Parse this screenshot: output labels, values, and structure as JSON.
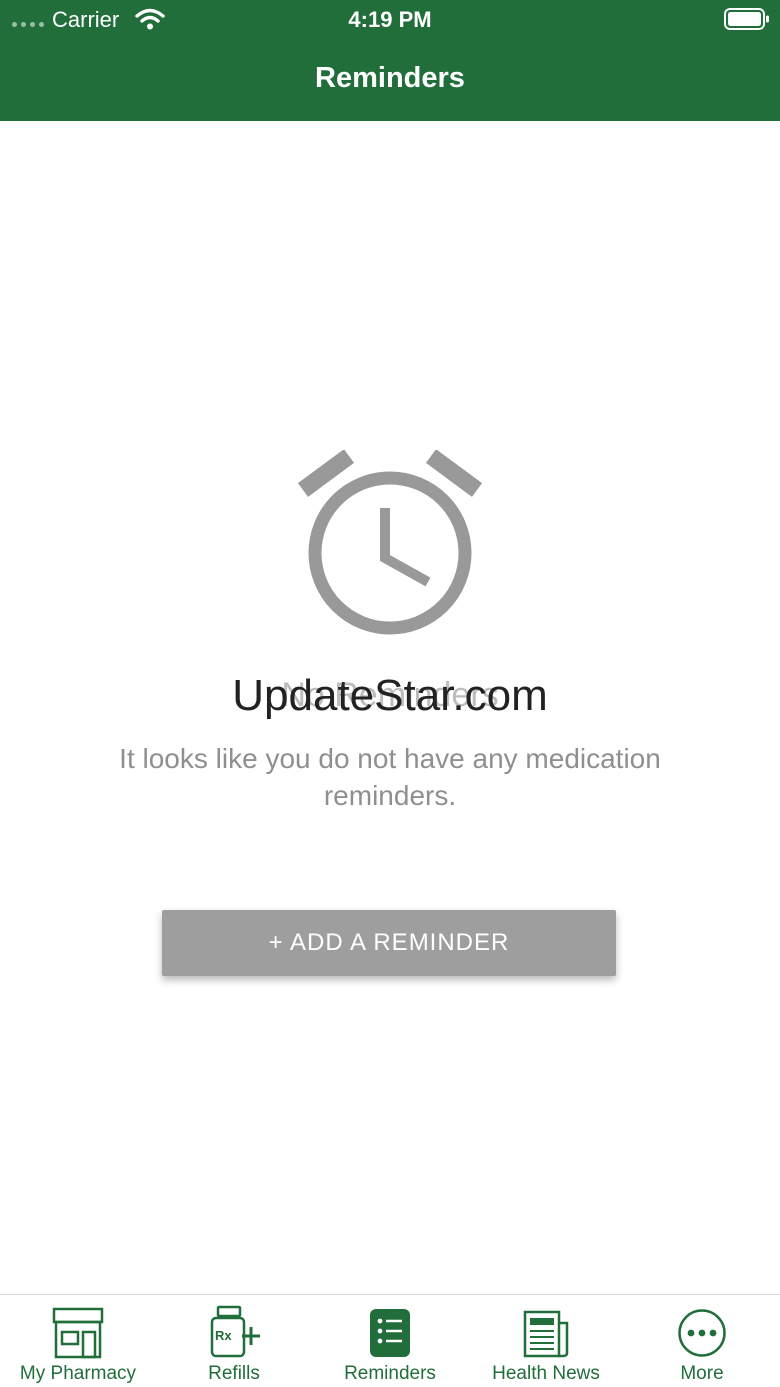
{
  "status_bar": {
    "carrier": "Carrier",
    "time": "4:19 PM"
  },
  "header": {
    "title": "Reminders"
  },
  "empty_state": {
    "icon": "alarm-clock-icon",
    "title": "No Reminders",
    "watermark": "UpdateStar.com",
    "message": "It looks like you do not have any medication reminders.",
    "button_label": "+ ADD A REMINDER"
  },
  "tab_bar": {
    "tabs": [
      {
        "label": "My Pharmacy",
        "icon": "pharmacy-store-icon"
      },
      {
        "label": "Refills",
        "icon": "rx-bottle-icon"
      },
      {
        "label": "Reminders",
        "icon": "reminders-list-icon",
        "selected": true
      },
      {
        "label": "Health News",
        "icon": "newspaper-icon"
      },
      {
        "label": "More",
        "icon": "more-dots-icon"
      }
    ]
  },
  "colors": {
    "brand_green": "#216e3a",
    "disabled_gray": "#9e9e9e",
    "icon_gray": "#999999",
    "text_gray": "#8f8f8f"
  }
}
